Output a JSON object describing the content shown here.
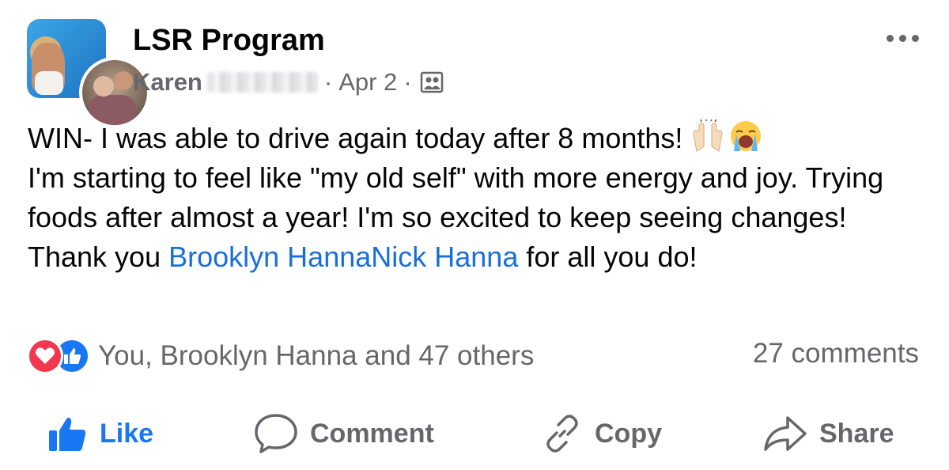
{
  "post": {
    "group_name": "LSR Program",
    "author_first": "Karen",
    "separator": "·",
    "date": "Apr 2",
    "body_line1": "WIN- I was able to drive again today after 8 months! ",
    "body_rest": "I'm starting to feel like \"my old self\" with more energy and joy. Trying foods after almost a year! I'm so excited to keep seeing changes!  Thank you ",
    "tag1": "Brooklyn Hanna",
    "tag2": "Nick Hanna",
    "body_end": " for all you do!",
    "emojis": [
      "raising-hands",
      "loudly-crying-face"
    ]
  },
  "engagement": {
    "reactions_text": "You, Brooklyn Hanna and 47 others",
    "comments_text": "27 comments",
    "reaction_icons": [
      "love-icon",
      "like-icon"
    ]
  },
  "actions": {
    "like": "Like",
    "comment": "Comment",
    "copy": "Copy",
    "share": "Share"
  },
  "colors": {
    "accent": "#1877f2",
    "link": "#1a6ed8",
    "secondary_text": "#65676b",
    "love": "#f0384e"
  }
}
